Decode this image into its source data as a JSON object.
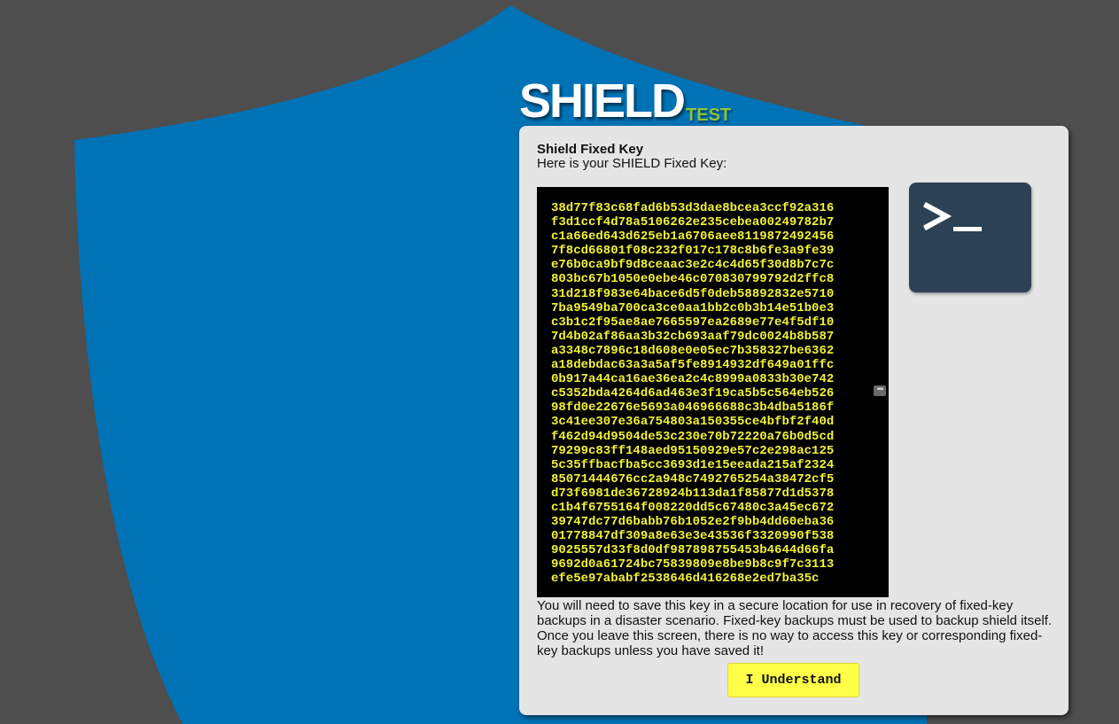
{
  "logo": {
    "name": "SHIELD",
    "environment": "TEST"
  },
  "colors": {
    "page_background": "#4e4e4e",
    "shield_blue": "#0073b7",
    "panel_background": "#e5e5e5",
    "key_text": "#f2f23a",
    "button_yellow": "#ffff4a",
    "environment_green": "#8fc33f",
    "terminal_icon_background": "#2d4154"
  },
  "panel": {
    "title": "Shield Fixed Key",
    "subtitle": "Here is your SHIELD Fixed Key:",
    "key_lines": [
      "38d77f83c68fad6b53d3dae8bcea3ccf92a316",
      "f3d1ccf4d78a5106262e235cebea00249782b7",
      "c1a66ed643d625eb1a6706aee8119872492456",
      "7f8cd66801f08c232f017c178c8b6fe3a9fe39",
      "e76b0ca9bf9d8ceaac3e2c4c4d65f30d8b7c7c",
      "803bc67b1050e0ebe46c070830799792d2ffc8",
      "31d218f983e64bace6d5f0deb58892832e5710",
      "7ba9549ba700ca3ce0aa1bb2c0b3b14e51b0e3",
      "c3b1c2f95ae8ae7665597ea2689e77e4f5df10",
      "7d4b02af86aa3b32cb693aaf79dc0024b8b587",
      "a3348c7896c18d608e0e05ec7b358327be6362",
      "a18debdac63a3a5af5fe8914932df649a01ffc",
      "0b917a44ca16ae36ea2c4c8999a0833b30e742",
      "c5352bda4264d6ad463e3f19ca5b5c564eb526",
      "98fd0e22676e5693a046966688c3b4dba5186f",
      "3c41ee307e36a754803a150355ce4bfbf2f40d",
      "f462d94d9504de53c230e70b72220a76b0d5cd",
      "79299c83ff148aed95150929e57c2e298ac125",
      "5c35ffbacfba5cc3693d1e15eeada215af2324",
      "85071444676cc2a948c7492765254a38472cf5",
      "d73f6981de36728924b113da1f85877d1d5378",
      "c1b4f6755164f008220dd5c67480c3a45ec672",
      "39747dc77d6babb76b1052e2f9bb4dd60eba36",
      "01778847df309a8e63e3e43536f3320990f538",
      "9025557d33f8d0df987898755453b4644d66fa",
      "9692d0a61724bc75839809e8be9b8c9f7c3113",
      "efe5e97ababf2538646d416268e2ed7ba35c"
    ],
    "icon": "terminal-icon",
    "description": "You will need to save this key in a secure location for use in recovery of fixed-key backups in a disaster scenario. Fixed-key backups must be used to backup shield itself. Once you leave this screen, there is no way to access this key or corresponding fixed-key backups unless you have saved it!",
    "button_label": "I Understand"
  }
}
